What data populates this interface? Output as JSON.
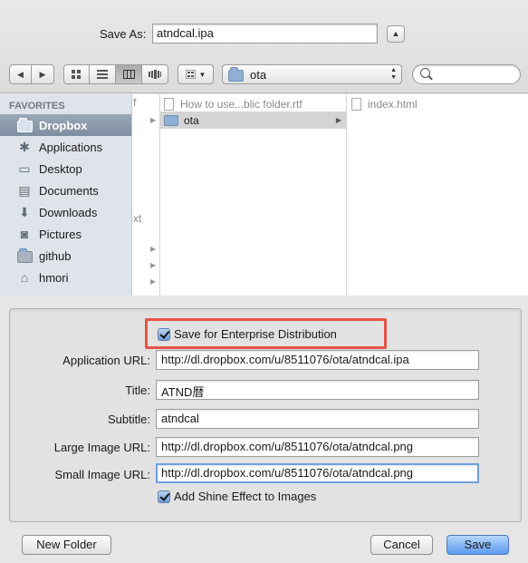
{
  "save_as": {
    "label": "Save As:",
    "value": "atndcal.ipa"
  },
  "toolbar": {
    "current_folder": "ota",
    "search_placeholder": ""
  },
  "sidebar": {
    "heading": "FAVORITES",
    "items": [
      {
        "label": "Dropbox",
        "icon": "folder-icon",
        "selected": true
      },
      {
        "label": "Applications",
        "icon": "applications-icon"
      },
      {
        "label": "Desktop",
        "icon": "desktop-icon"
      },
      {
        "label": "Documents",
        "icon": "documents-icon"
      },
      {
        "label": "Downloads",
        "icon": "downloads-icon"
      },
      {
        "label": "Pictures",
        "icon": "pictures-icon"
      },
      {
        "label": "github",
        "icon": "folder-icon"
      },
      {
        "label": "hmori",
        "icon": "home-icon"
      }
    ]
  },
  "browser": {
    "col0_fragments": [
      "f",
      "xt"
    ],
    "col1_items": [
      "How to use...blic folder.rtf",
      "ota"
    ],
    "col2_items": [
      "index.html"
    ]
  },
  "enterprise": {
    "checkbox_label": "Save for Enterprise Distribution",
    "fields": {
      "app_url_label": "Application URL:",
      "app_url_value": "http://dl.dropbox.com/u/8511076/ota/atndcal.ipa",
      "title_label": "Title:",
      "title_value": "ATND暦",
      "subtitle_label": "Subtitle:",
      "subtitle_value": "atndcal",
      "large_image_label": "Large Image URL:",
      "large_image_value": "http://dl.dropbox.com/u/8511076/ota/atndcal.png",
      "small_image_label": "Small Image URL:",
      "small_image_value": "http://dl.dropbox.com/u/8511076/ota/atndcal.png"
    },
    "shine_label": "Add Shine Effect to Images"
  },
  "buttons": {
    "new_folder": "New Folder",
    "cancel": "Cancel",
    "save": "Save"
  },
  "colors": {
    "highlight": "#e8524a",
    "accent": "#5b9bef",
    "sidebar_selected": "#8796a9"
  }
}
